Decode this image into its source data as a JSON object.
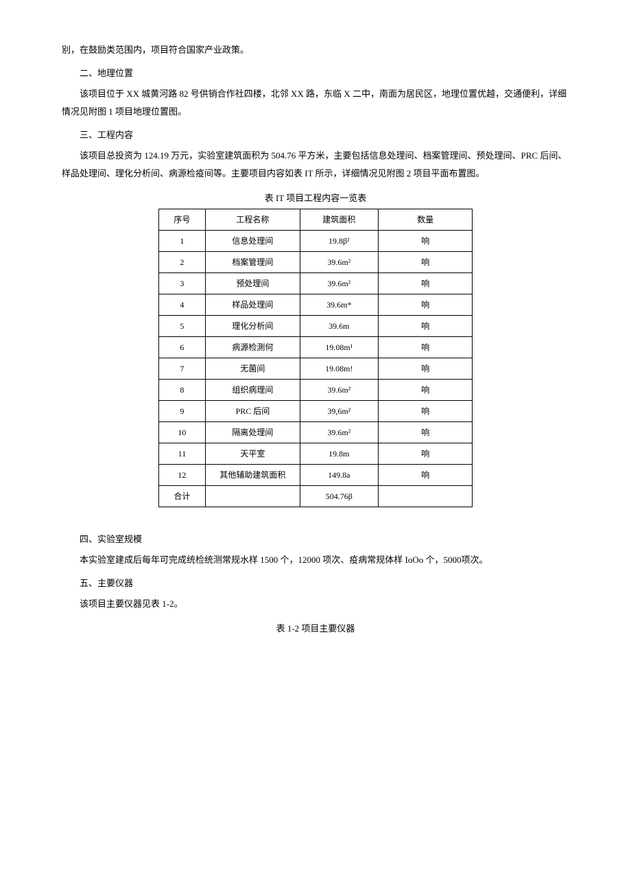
{
  "para1": "别，在鼓励类范围内，项目符合国家产业政策。",
  "heading2": "二、地理位置",
  "para2": "该项目位于 XX 城黄河路 82 号供销合作社四楼，北邻 XX 路，东临 X 二中，南面为居民区，地理位置优越，交通便利，详细情况见附图 1 项目地理位置图。",
  "heading3": "三、工程内容",
  "para3": "该项目总投资为 124.19 万元，实验室建筑面积为 504.76 平方米，主要包括信息处理间、档案管理间、预处理间、PRC 后间、样品处理间、理化分析间、病源检疫间等。主要项目内容如表 IT 所示，详细情况见附图 2 项目平面布置图。",
  "table1": {
    "caption": "表 IT 项目工程内容一览表",
    "headers": [
      "序号",
      "工程名称",
      "建筑面积",
      "数量"
    ],
    "rows": [
      [
        "1",
        "信息处理间",
        "19.8β²",
        "响"
      ],
      [
        "2",
        "档案管理间",
        "39.6m²",
        "响"
      ],
      [
        "3",
        "预处理间",
        "39.6m²",
        "响"
      ],
      [
        "4",
        "样品处理间",
        "39.6m*",
        "响"
      ],
      [
        "5",
        "理化分析间",
        "39.6m",
        "响"
      ],
      [
        "6",
        "病源检測何",
        "19.08m¹",
        "响"
      ],
      [
        "7",
        "无菌间",
        "19.08m!",
        "响"
      ],
      [
        "8",
        "组织病理间",
        "39.6m²",
        "响"
      ],
      [
        "9",
        "PRC 后间",
        "39,6m²",
        "响"
      ],
      [
        "10",
        "隔离处理间",
        "39.6m²",
        "响"
      ],
      [
        "11",
        "天平室",
        "19.8m",
        "响"
      ],
      [
        "12",
        "其他辅助建筑面积",
        "149.8a",
        "响"
      ]
    ],
    "totalLabel": "合计",
    "totalArea": "504.76β"
  },
  "heading4": "四、实验室规模",
  "para4": "本实验室建成后每年可完成统检统测常规水样 1500 个，12000 项次、疫病常规体样 IoOo 个，5000项次。",
  "heading5": "五、主要仪器",
  "para5": "该项目主要仪器见表 1-2。",
  "table2Caption": "表 1-2 项目主要仪器"
}
